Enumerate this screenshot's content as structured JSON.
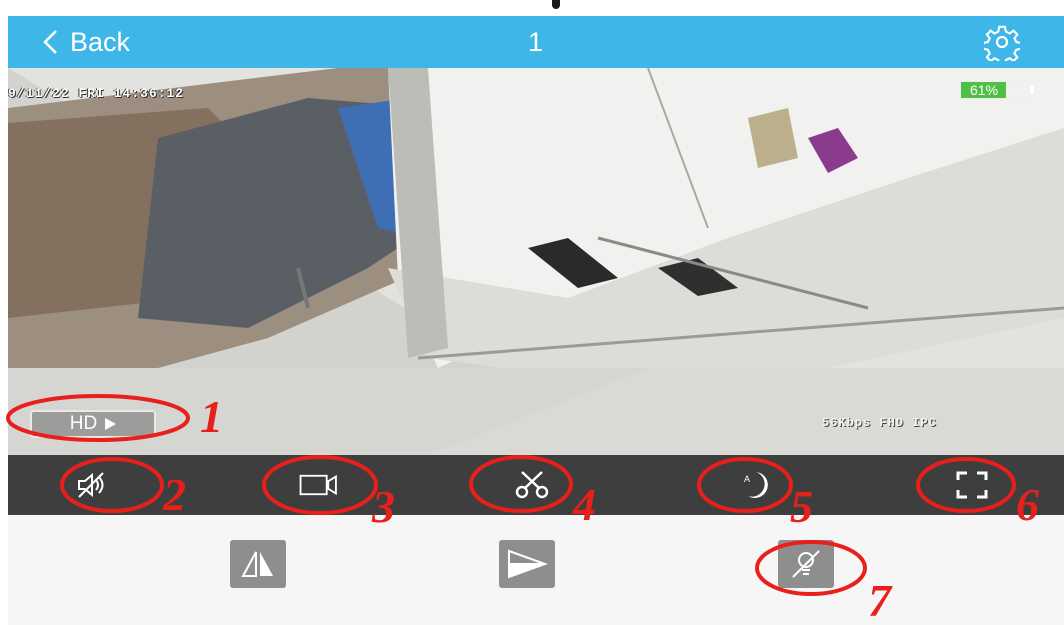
{
  "header": {
    "back_label": "Back",
    "title": "1",
    "background_color": "#3eb6e8"
  },
  "video": {
    "timestamp": "9/11/22  FRI 14:36:12",
    "battery_text": "61%",
    "battery_level": 0.61,
    "stream_info": "56Kbps FHD IPC",
    "quality_button_label": "HD"
  },
  "toolbar": {
    "background_color": "#3e3e3e",
    "icons": [
      "mute-icon",
      "record-icon",
      "snapshot-scissors-icon",
      "night-mode-icon",
      "fullscreen-icon"
    ]
  },
  "controls": {
    "icons": [
      "mirror-flip-icon",
      "vertical-flip-icon",
      "light-off-icon"
    ]
  },
  "annotations": {
    "color": "#e8201c",
    "labels": [
      "1",
      "2",
      "3",
      "4",
      "5",
      "6",
      "7"
    ]
  }
}
